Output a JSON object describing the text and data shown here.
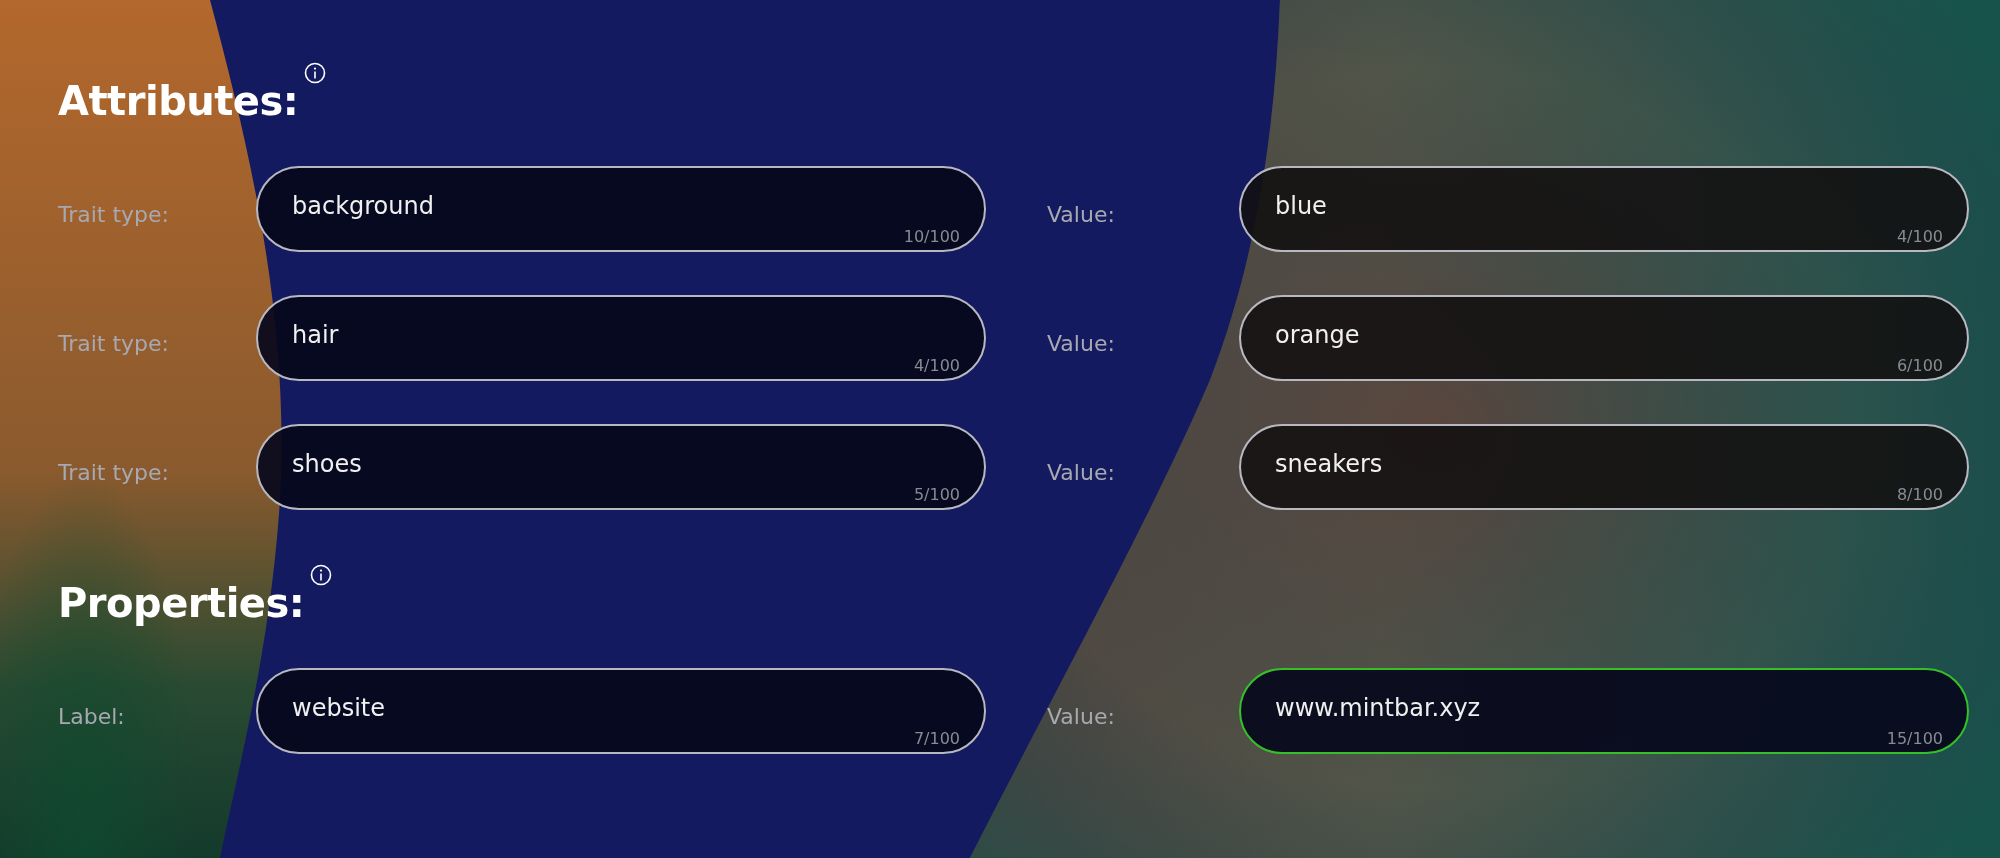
{
  "sections": [
    {
      "title": "Attributes:",
      "rows": [
        {
          "label": "Trait type:",
          "field": {
            "value": "background",
            "counter": "10/100",
            "focused": false
          },
          "value_label": "Value:",
          "value_field": {
            "value": "blue",
            "counter": "4/100",
            "focused": false
          }
        },
        {
          "label": "Trait type:",
          "field": {
            "value": "hair",
            "counter": "4/100",
            "focused": false
          },
          "value_label": "Value:",
          "value_field": {
            "value": "orange",
            "counter": "6/100",
            "focused": false
          }
        },
        {
          "label": "Trait type:",
          "field": {
            "value": "shoes",
            "counter": "5/100",
            "focused": false
          },
          "value_label": "Value:",
          "value_field": {
            "value": "sneakers",
            "counter": "8/100",
            "focused": false
          }
        }
      ]
    },
    {
      "title": "Properties:",
      "rows": [
        {
          "label": "Label:",
          "field": {
            "value": "website",
            "counter": "7/100",
            "focused": false
          },
          "value_label": "Value:",
          "value_field": {
            "value": "www.mintbar.xyz",
            "counter": "15/100",
            "focused": true
          }
        }
      ]
    }
  ]
}
